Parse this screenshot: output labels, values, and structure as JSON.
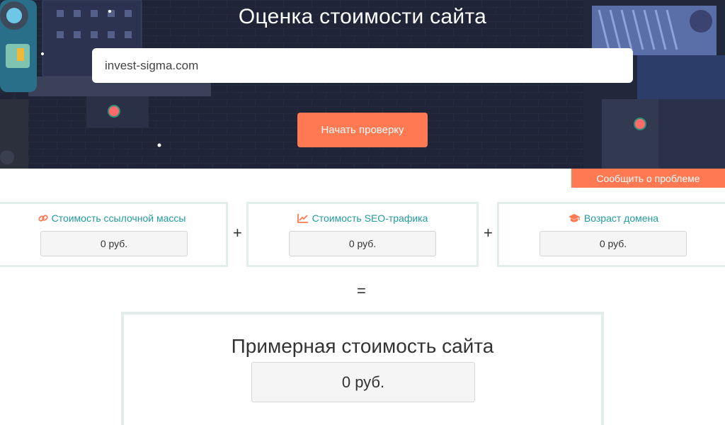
{
  "hero": {
    "title": "Оценка стоимости сайта",
    "url_value": "invest-sigma.com",
    "start_button": "Начать проверку"
  },
  "report_button": "Сообщить о проблеме",
  "metrics": [
    {
      "label": "Стоимость ссылочной массы",
      "value": "0 руб.",
      "icon": "link-icon"
    },
    {
      "label": "Стоимость SEO-трафика",
      "value": "0 руб.",
      "icon": "chart-line-icon"
    },
    {
      "label": "Возраст домена",
      "value": "0 руб.",
      "icon": "graduation-cap-icon"
    }
  ],
  "operators": {
    "plus": "+",
    "equals": "="
  },
  "total": {
    "title": "Примерная стоимость сайта",
    "value": "0 руб."
  },
  "colors": {
    "accent": "#ff7a53",
    "teal": "#239b9d",
    "hero_bg": "#1f2436",
    "card_border": "#e3eeec"
  }
}
